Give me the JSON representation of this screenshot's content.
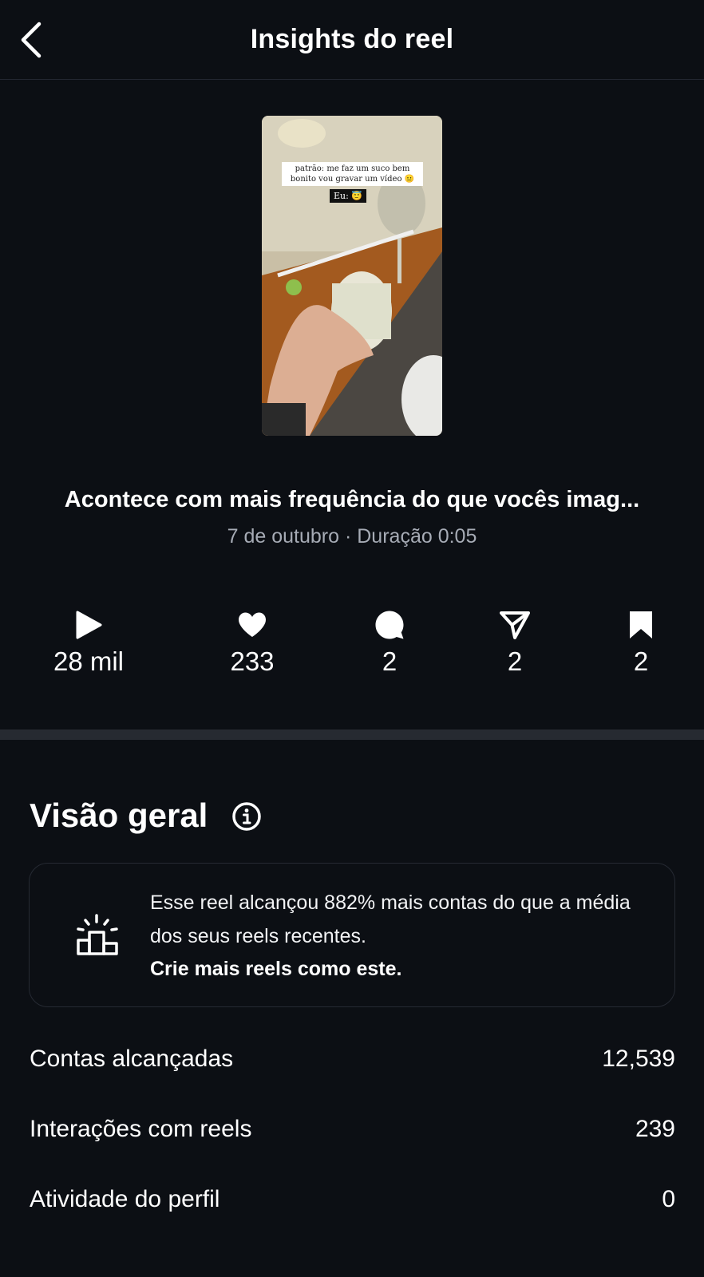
{
  "header": {
    "title": "Insights do reel"
  },
  "thumbnail": {
    "caption": "patrão: me faz um suco bem bonito vou gravar um vídeo 😐",
    "eu_label": "Eu: 😇"
  },
  "reel": {
    "title": "Acontece com mais frequência do que vocês imag...",
    "meta": "7 de outubro · Duração 0:05"
  },
  "stats": {
    "plays": "28 mil",
    "likes": "233",
    "comments": "2",
    "shares": "2",
    "saves": "2"
  },
  "overview": {
    "title": "Visão geral",
    "card_text": "Esse reel alcançou 882% mais contas do que a média dos seus reels recentes.",
    "card_cta": "Crie mais reels como este.",
    "metrics": [
      {
        "label": "Contas alcançadas",
        "value": "12,539"
      },
      {
        "label": "Interações com reels",
        "value": "239"
      },
      {
        "label": "Atividade do perfil",
        "value": "0"
      }
    ]
  },
  "colors": {
    "background": "#0c0f14",
    "secondary_text": "#a6abb5",
    "divider": "#262a31"
  },
  "icons": [
    "chevron-left-icon",
    "play-icon",
    "heart-icon",
    "comment-icon",
    "share-icon",
    "bookmark-icon",
    "info-icon",
    "podium-icon"
  ]
}
